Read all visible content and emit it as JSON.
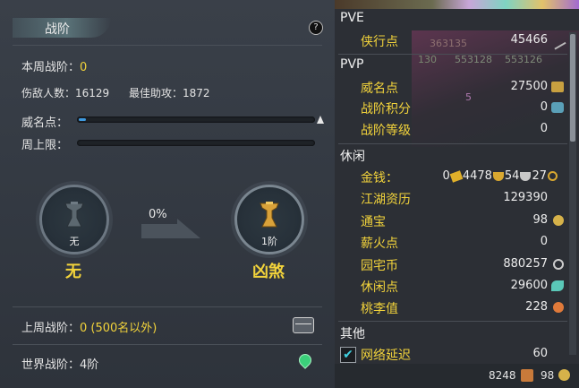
{
  "left": {
    "title": "战阶",
    "help": "?",
    "weekly_rank_label": "本周战阶：",
    "weekly_rank_value": "0",
    "damage_count_label": "伤敌人数：",
    "damage_count_value": "16129",
    "best_assist_label": "最佳助攻：",
    "best_assist_value": "1872",
    "prestige_label": "威名点：",
    "prestige_progress": 0.02,
    "weekly_cap_label": "周上限：",
    "weekly_cap_progress": 0,
    "current_tier": {
      "small": "无",
      "name": "无"
    },
    "progress_pct": "0%",
    "next_tier": {
      "small": "1阶",
      "name": "凶煞"
    },
    "last_week_label": "上周战阶：",
    "last_week_value": "0 (500名以外)",
    "world_rank_label": "世界战阶：",
    "world_rank_value": "4阶"
  },
  "right": {
    "sections": {
      "pve": "PVE",
      "pvp": "PVP",
      "leisure": "休闲",
      "other": "其他"
    },
    "pve_rows": [
      {
        "key": "侠行点",
        "value": "45466"
      }
    ],
    "pvp_rows": [
      {
        "key": "威名点",
        "value": "27500"
      },
      {
        "key": "战阶积分",
        "value": "0"
      },
      {
        "key": "战阶等级",
        "value": "0"
      }
    ],
    "money": {
      "key": "金钱：",
      "a": "0",
      "b": "4478",
      "c": "54",
      "d": "27"
    },
    "leisure_rows": [
      {
        "key": "江湖资历",
        "value": "129390"
      },
      {
        "key": "通宝",
        "value": "98"
      },
      {
        "key": "薪火点",
        "value": "0"
      },
      {
        "key": "园宅币",
        "value": "880257"
      },
      {
        "key": "休闲点",
        "value": "29600"
      },
      {
        "key": "桃李值",
        "value": "228"
      }
    ],
    "network_label": "网络延迟",
    "network_value": "60",
    "bottom_a": "8248",
    "bottom_b": "98",
    "bg_numbers": [
      "363135",
      "130",
      "553128",
      "553126",
      "5"
    ]
  },
  "colors": {
    "accent": "#f2d33b",
    "bar_fill": "#3e9ae0",
    "panel": "#3a4049"
  },
  "icons": [
    "help-icon",
    "caret-up-icon",
    "bell-medal-icon",
    "chest-icon",
    "location-pin-icon",
    "coin-icon",
    "check-icon"
  ]
}
